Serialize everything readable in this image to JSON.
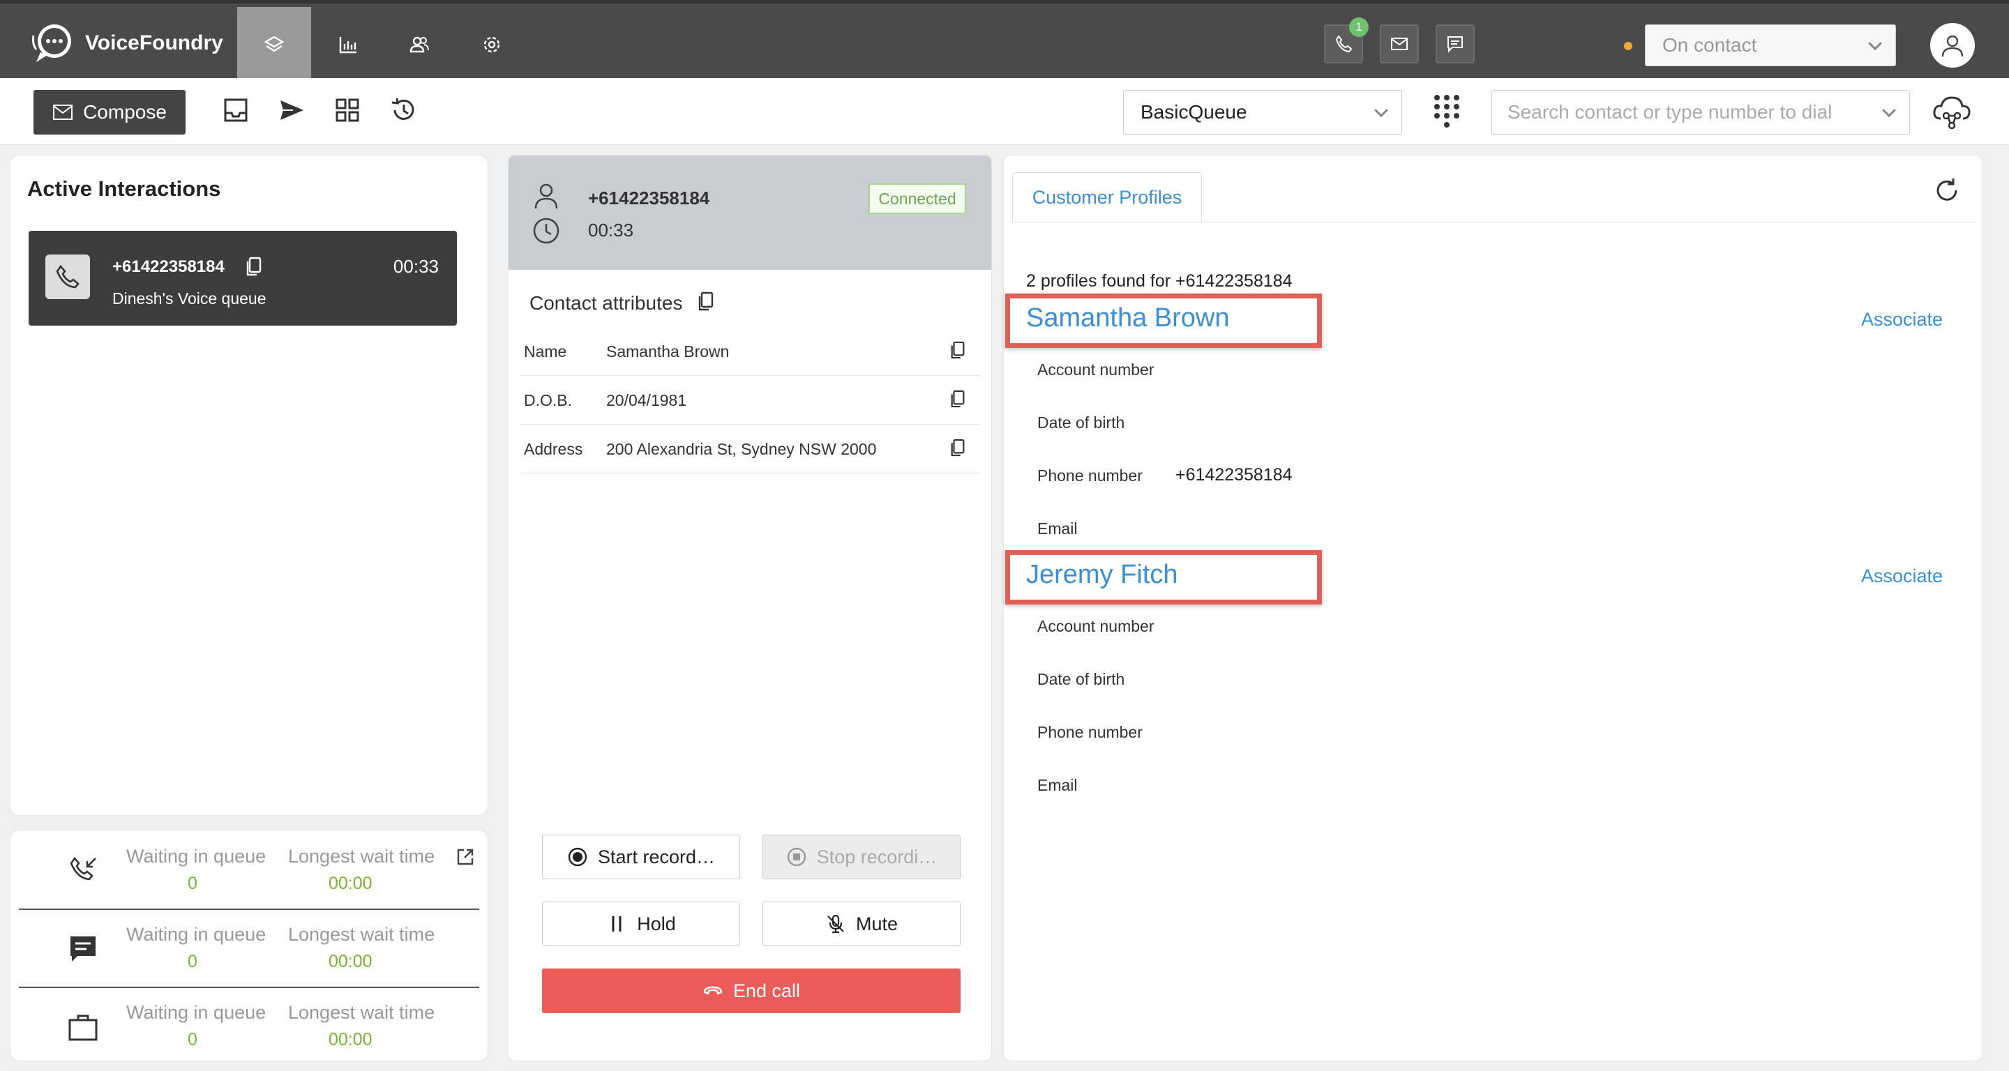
{
  "app": {
    "brand": "VoiceFoundry"
  },
  "topbar": {
    "nav": [
      {
        "name": "layers-icon",
        "active": true
      },
      {
        "name": "bar-chart-icon",
        "active": false
      },
      {
        "name": "users-icon",
        "active": false
      },
      {
        "name": "gear-icon",
        "active": false
      }
    ],
    "phone_badge": "1",
    "agent_status": "On contact",
    "status_color": "#f0a830"
  },
  "toolbar": {
    "compose_label": "Compose",
    "queue": "BasicQueue",
    "search_placeholder": "Search contact or type number to dial"
  },
  "active_interactions": {
    "title": "Active Interactions",
    "items": [
      {
        "number": "+61422358184",
        "queue": "Dinesh's Voice queue",
        "time": "00:33"
      }
    ]
  },
  "queue_stats": [
    {
      "icon": "incoming-call-icon",
      "waiting_label": "Waiting in queue",
      "waiting": "0",
      "longest_label": "Longest wait time",
      "longest": "00:00"
    },
    {
      "icon": "chat-icon",
      "waiting_label": "Waiting in queue",
      "waiting": "0",
      "longest_label": "Longest wait time",
      "longest": "00:00"
    },
    {
      "icon": "briefcase-icon",
      "waiting_label": "Waiting in queue",
      "waiting": "0",
      "longest_label": "Longest wait time",
      "longest": "00:00"
    }
  ],
  "call": {
    "number": "+61422358184",
    "duration": "00:33",
    "status": "Connected",
    "attributes_title": "Contact attributes",
    "attributes": [
      {
        "key": "Name",
        "value": "Samantha Brown"
      },
      {
        "key": "D.O.B.",
        "value": "20/04/1981"
      },
      {
        "key": "Address",
        "value": "200 Alexandria St, Sydney NSW 2000"
      }
    ],
    "buttons": {
      "start_record": "Start record…",
      "stop_record": "Stop recordi…",
      "hold": "Hold",
      "mute": "Mute",
      "end_call": "End call"
    }
  },
  "profiles": {
    "tab": "Customer Profiles",
    "found_text": "2 profiles found for +61422358184",
    "associate_label": "Associate",
    "list": [
      {
        "name": "Samantha Brown",
        "fields": [
          {
            "label": "Account number",
            "value": ""
          },
          {
            "label": "Date of birth",
            "value": ""
          },
          {
            "label": "Phone number",
            "value": "+61422358184"
          },
          {
            "label": "Email",
            "value": ""
          }
        ]
      },
      {
        "name": "Jeremy Fitch",
        "fields": [
          {
            "label": "Account number",
            "value": ""
          },
          {
            "label": "Date of birth",
            "value": ""
          },
          {
            "label": "Phone number",
            "value": ""
          },
          {
            "label": "Email",
            "value": ""
          }
        ]
      }
    ],
    "highlight_color": "#e06055"
  }
}
